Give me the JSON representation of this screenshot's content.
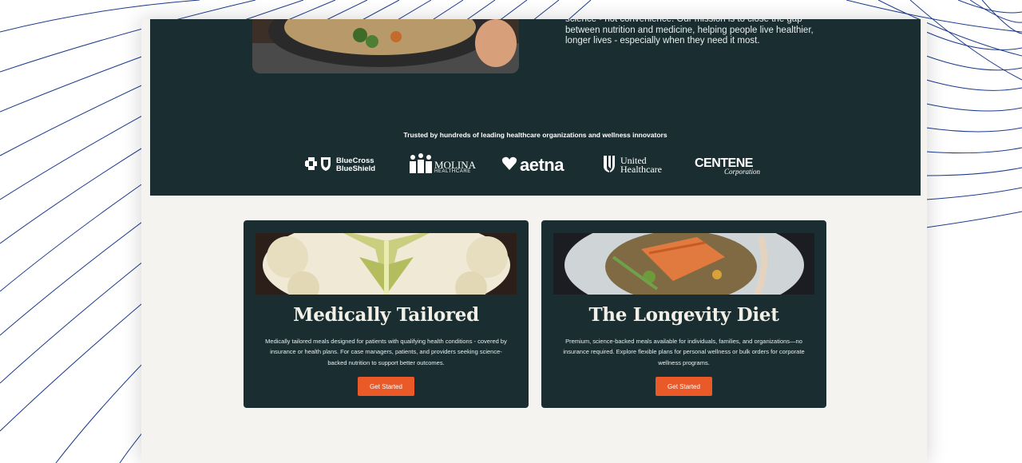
{
  "hero": {
    "mission_text": "science - not convenience. Our mission is to close the gap between nutrition and medicine, helping people live healthier, longer lives - especially when they need it most."
  },
  "trusted": {
    "text": "Trusted by hundreds of leading healthcare organizations and wellness innovators"
  },
  "logos": {
    "bcbs": [
      "BlueCross",
      "BlueShield"
    ],
    "molina": [
      "MOLINA",
      "HEALTHCARE"
    ],
    "aetna": "aetna",
    "uhc": [
      "United",
      "Healthcare"
    ],
    "centene": [
      "CENTENE",
      "Corporation"
    ]
  },
  "cards": [
    {
      "title": "Medically Tailored",
      "description": "Medically tailored meals designed for patients with qualifying health conditions - covered by insurance or health plans. For case managers, patients, and providers seeking science-backed nutrition to support better outcomes.",
      "button": "Get Started"
    },
    {
      "title": "The Longevity Diet",
      "description": "Premium, science-backed meals available for individuals, families, and organizations—no insurance required. Explore flexible plans for personal wellness or bulk orders for corporate wellness programs.",
      "button": "Get Started"
    }
  ],
  "colors": {
    "dark_teal": "#1a2e31",
    "accent_orange": "#ea5a28",
    "cream": "#f5f3ef",
    "line_navy": "#1b3a8c"
  },
  "icons": [
    "bcbs-cross-shield-icon",
    "molina-people-icon",
    "aetna-heart-icon",
    "uhc-shield-icon"
  ]
}
